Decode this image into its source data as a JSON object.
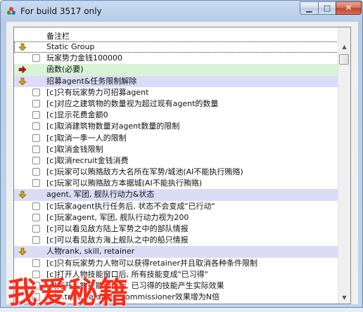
{
  "window": {
    "title": "For build 3517 only",
    "controls": {
      "min_icon": "minimize-icon",
      "max_icon": "maximize-icon",
      "close_icon": "close-icon"
    }
  },
  "list": {
    "header": "备注栏",
    "rows": [
      {
        "type": "group",
        "icon": "arrow-down-icon",
        "arrow_color": "#d9a400",
        "text": "Static Group",
        "selected": true
      },
      {
        "type": "item",
        "text": "玩家势力金钱100000"
      },
      {
        "type": "green",
        "icon": "arrow-right-icon",
        "arrow_color": "#d6001c",
        "text": "函数(必要)"
      },
      {
        "type": "group",
        "icon": "arrow-down-icon",
        "arrow_color": "#d9a400",
        "text": "招募agent&任务限制解除"
      },
      {
        "type": "item",
        "text": "[c]只有玩家势力可招募agent"
      },
      {
        "type": "item",
        "text": "[c]对应之建筑物的数量视为超过现有agent的数量"
      },
      {
        "type": "item",
        "text": "[c]显示花费金额0"
      },
      {
        "type": "item",
        "text": "[c]取消建筑物数量对agent数量的限制"
      },
      {
        "type": "item",
        "text": "[c]取消一季一人的限制"
      },
      {
        "type": "item",
        "text": "[c]取消金钱限制"
      },
      {
        "type": "item",
        "text": "[c]取消recruit金钱消费"
      },
      {
        "type": "item",
        "text": "[c]玩家可以贿赂敌方大名所在军势/城池(AI不能执行贿赂)"
      },
      {
        "type": "item",
        "text": "[c]玩家可以贿赂敌方本据城(AI不能执行贿赂)"
      },
      {
        "type": "group",
        "icon": "arrow-down-icon",
        "arrow_color": "#d9a400",
        "text": "agent, 军团, 舰队行动力&状态"
      },
      {
        "type": "item",
        "text": "[c]玩家agent执行任务后, 状态不会变成\"已行动\""
      },
      {
        "type": "item",
        "text": "[c]玩家agent, 军团, 舰队行动力视为200"
      },
      {
        "type": "item",
        "text": "[c]可以看见敌方陆上军势之中的部队情报"
      },
      {
        "type": "item",
        "text": "[c]可以看见敌方海上舰队之中的船只情报"
      },
      {
        "type": "group",
        "icon": "arrow-down-icon",
        "arrow_color": "#d9a400",
        "text": "人物rank, skill, retainer"
      },
      {
        "type": "item",
        "text": "[c]只有玩家势力人物可以获得retainer并且取消各种条件限制"
      },
      {
        "type": "item",
        "text": "[c]打开人物技能窗口后, 所有技能变成\"已习得\""
      },
      {
        "type": "item",
        "text": "[c]打开人物技能窗口后, 已习得的技能产生实际效果"
      },
      {
        "type": "item",
        "text": "[c]…trait, retainer, commissioner效果增为N倍"
      }
    ]
  },
  "watermark": "我爱秘籍"
}
